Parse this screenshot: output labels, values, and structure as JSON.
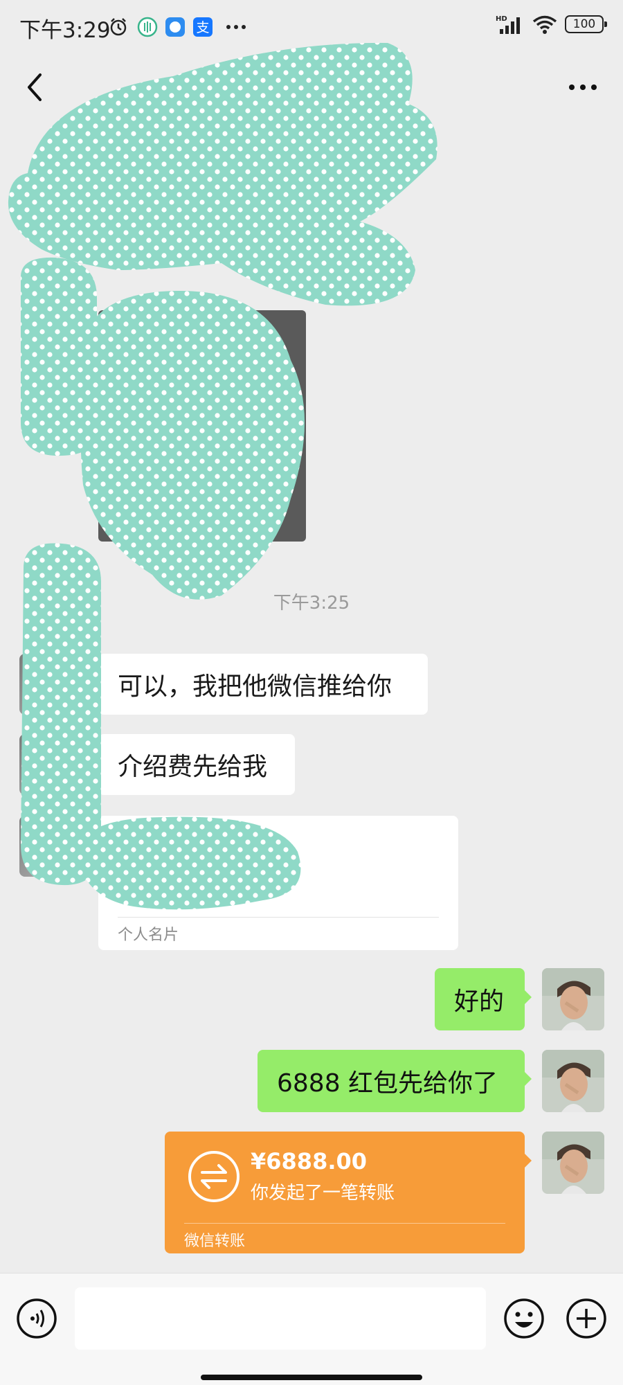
{
  "status_bar": {
    "time": "下午3:29",
    "icons": [
      "alarm-icon",
      "green-app-icon",
      "blue-chat-app-icon",
      "alipay-icon",
      "more-dots-icon"
    ],
    "right_icons": [
      "hd-signal-icon",
      "wifi-icon"
    ],
    "battery": "100"
  },
  "header": {
    "back_icon": "chevron-left-icon",
    "more_icon": "more-horizontal-icon"
  },
  "chat": {
    "time_divider": "下午3:25",
    "incoming": [
      {
        "text": "可以，我把他微信推给你"
      },
      {
        "text": "介绍费先给我"
      }
    ],
    "contact_card": {
      "label": "个人名片"
    },
    "outgoing": [
      {
        "text": "好的"
      },
      {
        "text": "6888 红包先给你了"
      }
    ],
    "transfer": {
      "amount": "¥6888.00",
      "description": "你发起了一笔转账",
      "label": "微信转账",
      "color": "#f79c39"
    }
  },
  "input_bar": {
    "placeholder": "",
    "value": "",
    "icons": [
      "voice-icon",
      "emoji-icon",
      "plus-icon"
    ]
  },
  "colors": {
    "background": "#ededed",
    "outgoing_bubble": "#95ec69",
    "incoming_bubble": "#ffffff",
    "redaction": "#8fd9c7"
  }
}
